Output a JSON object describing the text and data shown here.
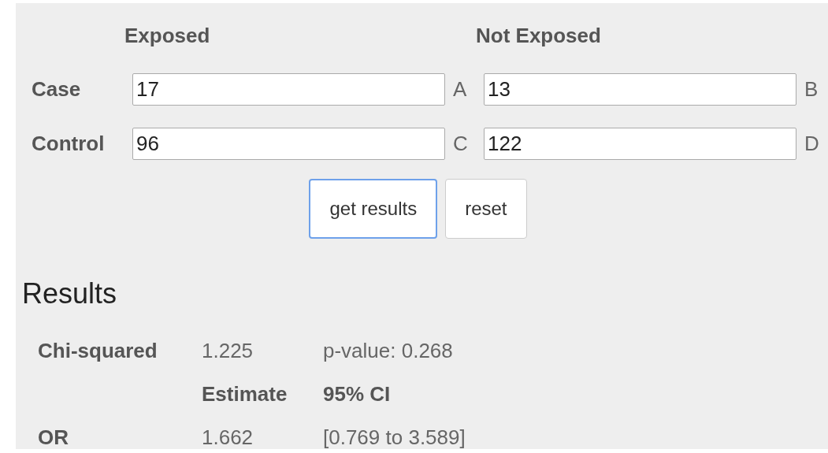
{
  "columns": [
    "Exposed",
    "Not Exposed"
  ],
  "rows": [
    {
      "label": "Case",
      "cells": [
        {
          "value": "17",
          "letter": "A"
        },
        {
          "value": "13",
          "letter": "B"
        }
      ]
    },
    {
      "label": "Control",
      "cells": [
        {
          "value": "96",
          "letter": "C"
        },
        {
          "value": "122",
          "letter": "D"
        }
      ]
    }
  ],
  "buttons": [
    {
      "label": "get results",
      "focused": true
    },
    {
      "label": "reset",
      "focused": false
    }
  ],
  "results": {
    "title": "Results",
    "rows": [
      {
        "label": "Chi-squared",
        "cells": [
          {
            "text": "1.225",
            "bold": false
          },
          {
            "text": "p-value: 0.268",
            "bold": false
          }
        ]
      },
      {
        "cells": [
          {
            "text": "Estimate",
            "bold": true
          },
          {
            "text": "95% CI",
            "bold": true
          }
        ]
      },
      {
        "label": "OR",
        "cells": [
          {
            "text": "1.662",
            "bold": false
          },
          {
            "text": "[0.769 to 3.589]",
            "bold": false
          }
        ]
      }
    ]
  }
}
